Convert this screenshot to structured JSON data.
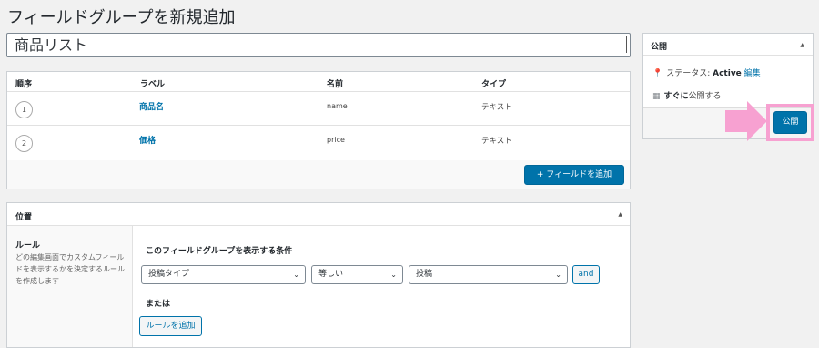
{
  "page_title": "フィールドグループを新規追加",
  "title_input": {
    "value": "商品リスト"
  },
  "fields": {
    "headers": {
      "order": "順序",
      "label": "ラベル",
      "name": "名前",
      "type": "タイプ"
    },
    "rows": [
      {
        "order": "1",
        "label": "商品名",
        "name": "name",
        "type": "テキスト"
      },
      {
        "order": "2",
        "label": "価格",
        "name": "price",
        "type": "テキスト"
      }
    ],
    "add_button": "+ フィールドを追加"
  },
  "location": {
    "title": "位置",
    "rules_title": "ルール",
    "rules_desc": "どの編集画面でカスタムフィールドを表示するかを決定するルールを作成します",
    "condition_title": "このフィールドグループを表示する条件",
    "param_select": "投稿タイプ",
    "operator_select": "等しい",
    "value_select": "投稿",
    "and_button": "and",
    "or_text": "または",
    "add_rule_button": "ルールを追加"
  },
  "publish": {
    "title": "公開",
    "status_label": "ステータス: ",
    "status_value": "Active",
    "edit_link": "編集",
    "time_prefix": "すぐに",
    "time_suffix": "公開する",
    "publish_button": "公開"
  },
  "colors": {
    "accent": "#0073aa",
    "highlight": "#f7a1d1"
  },
  "icons": {
    "status": "pin-icon",
    "calendar": "calendar-icon",
    "collapse": "caret-up-icon",
    "dropdown": "chevron-down-icon",
    "annotation": "arrow-right-icon"
  }
}
